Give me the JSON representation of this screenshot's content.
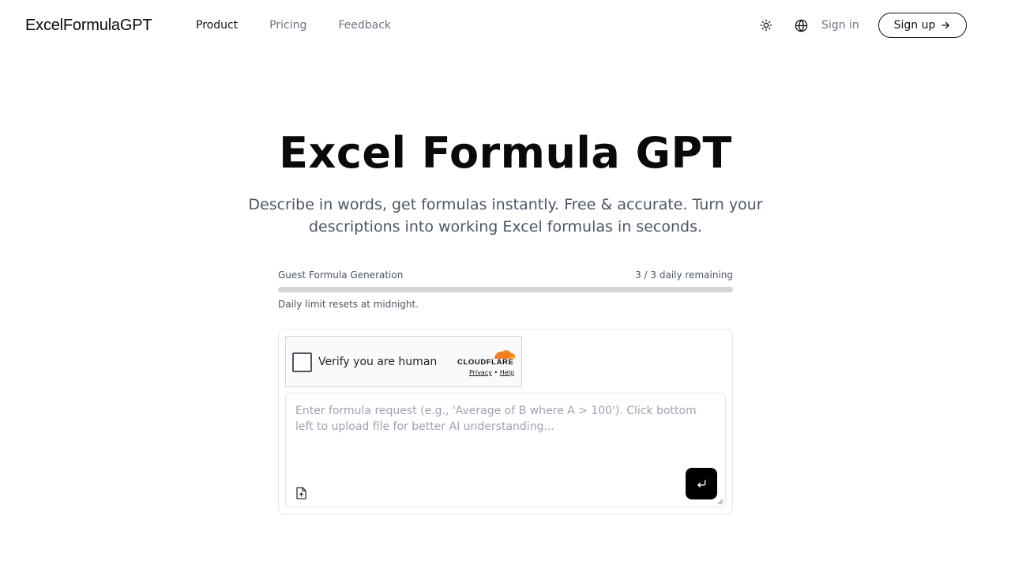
{
  "header": {
    "logo": "ExcelFormulaGPT",
    "nav": [
      {
        "label": "Product",
        "active": true
      },
      {
        "label": "Pricing",
        "active": false
      },
      {
        "label": "Feedback",
        "active": false
      }
    ],
    "theme_icon": "sun-icon",
    "language_icon": "globe-icon",
    "signin_label": "Sign in",
    "signup_label": "Sign up",
    "signup_icon": "arrow-right-icon"
  },
  "hero": {
    "title": "Excel Formula GPT",
    "subtitle": "Describe in words, get formulas instantly. Free & accurate. Turn your descriptions into working Excel formulas in seconds."
  },
  "usage": {
    "label": "Guest Formula Generation",
    "remaining_text": "3 / 3 daily remaining",
    "used": 0,
    "limit": 3,
    "note": "Daily limit resets at midnight."
  },
  "captcha": {
    "label": "Verify you are human",
    "brand": "CLOUDFLARE",
    "privacy_link": "Privacy",
    "separator": "•",
    "help_link": "Help",
    "brand_color": "#f38020"
  },
  "composer": {
    "placeholder": "Enter formula request (e.g., 'Average of B where A > 100'). Click bottom left to upload file for better AI understanding...",
    "upload_icon": "file-upload-icon",
    "send_icon": "enter-icon"
  }
}
